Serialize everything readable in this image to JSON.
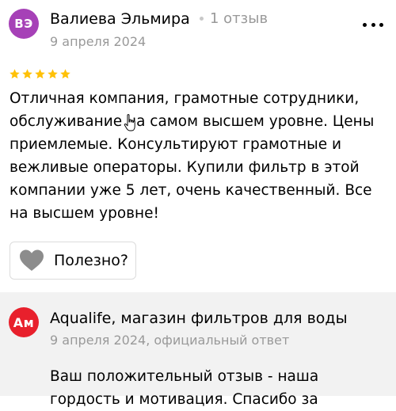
{
  "review": {
    "author_initials": "ВЭ",
    "author_name": "Валиева Эльмира",
    "author_reviews_count": "1 отзыв",
    "date": "9 апреля 2024",
    "rating": 5,
    "rating_max": 5,
    "text": "Отличная компания, грамотные сотрудники, обслуживание на самом высшем уровне. Цены приемлемые. Консультируют грамотные и вежливые операторы. Купили фильтр в этой компании уже 5 лет, очень качественный. Все на высшем уровне!",
    "useful_label": "Полезно?"
  },
  "reply": {
    "org_initials": "Ам",
    "org_name": "Aqualife, магазин фильтров для воды",
    "meta": "9 апреля 2024, официальный ответ",
    "text": "Ваш положительный отзыв - наша гордость и мотивация. Спасибо за"
  },
  "colors": {
    "author_avatar": "#a641b7",
    "org_avatar": "#e8202c",
    "star": "#ffc107",
    "reply_background": "#f2f2f2",
    "muted_text": "#999999"
  },
  "icons": {
    "menu": "more-horizontal-icon",
    "rating": "star-icon",
    "useful": "heart-icon",
    "cursor": "hand-pointer-icon"
  }
}
